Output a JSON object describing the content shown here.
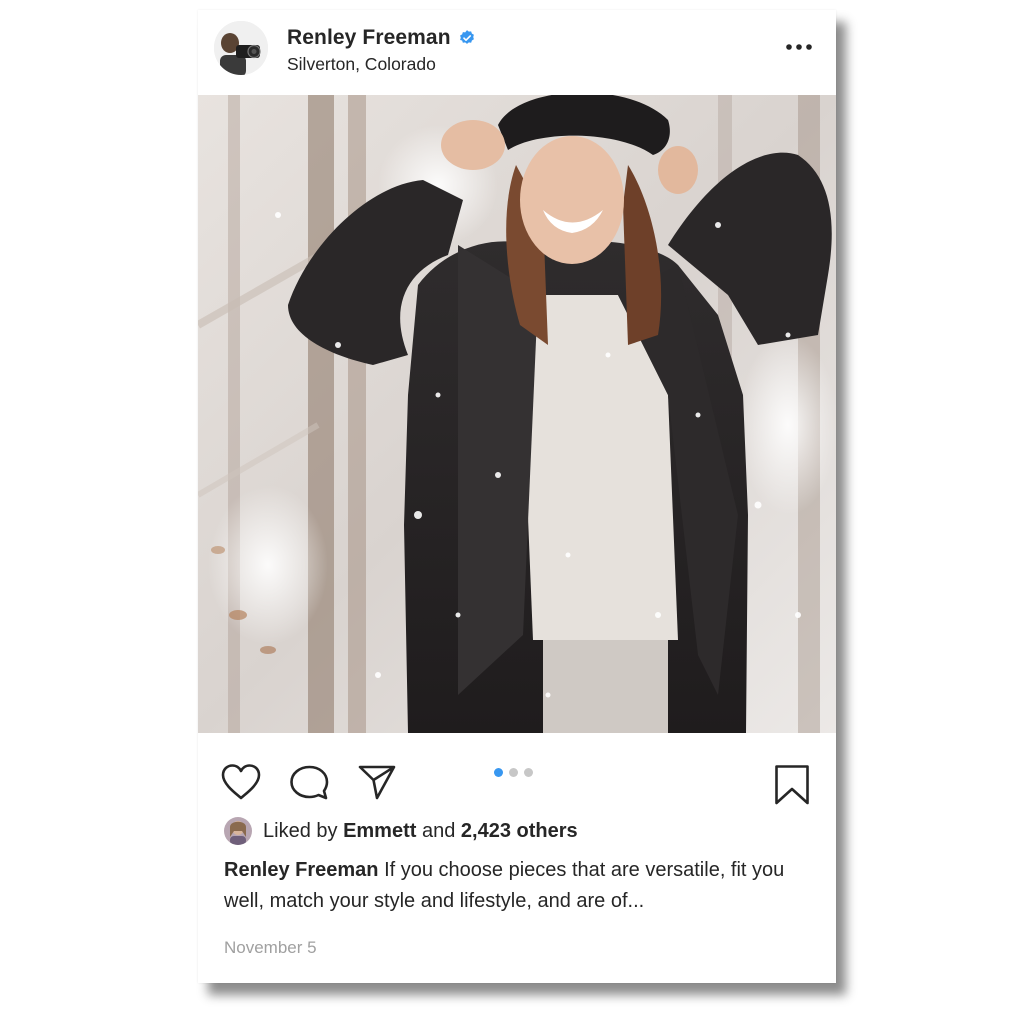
{
  "post": {
    "username": "Renley Freeman",
    "location": "Silverton, Colorado",
    "verified": true,
    "more_icon": "more-horizontal-icon",
    "photo_description": "",
    "carousel": {
      "total": 3,
      "active": 1
    },
    "actions": {
      "like_icon": "heart-icon",
      "comment_icon": "comment-icon",
      "share_icon": "paper-plane-icon",
      "save_icon": "bookmark-icon"
    },
    "likes": {
      "prefix": "Liked by",
      "user": "Emmett",
      "connector": "and",
      "others": "2,423 others"
    },
    "caption": {
      "author": "Renley Freeman",
      "text": "If you choose pieces that are versatile, fit you well, match your style and lifestyle, and are of..."
    },
    "date": "November 5"
  },
  "colors": {
    "text": "#262626",
    "muted": "#a0a0a0",
    "accent": "#3897f0",
    "dot_inactive": "#c7c7c7"
  }
}
